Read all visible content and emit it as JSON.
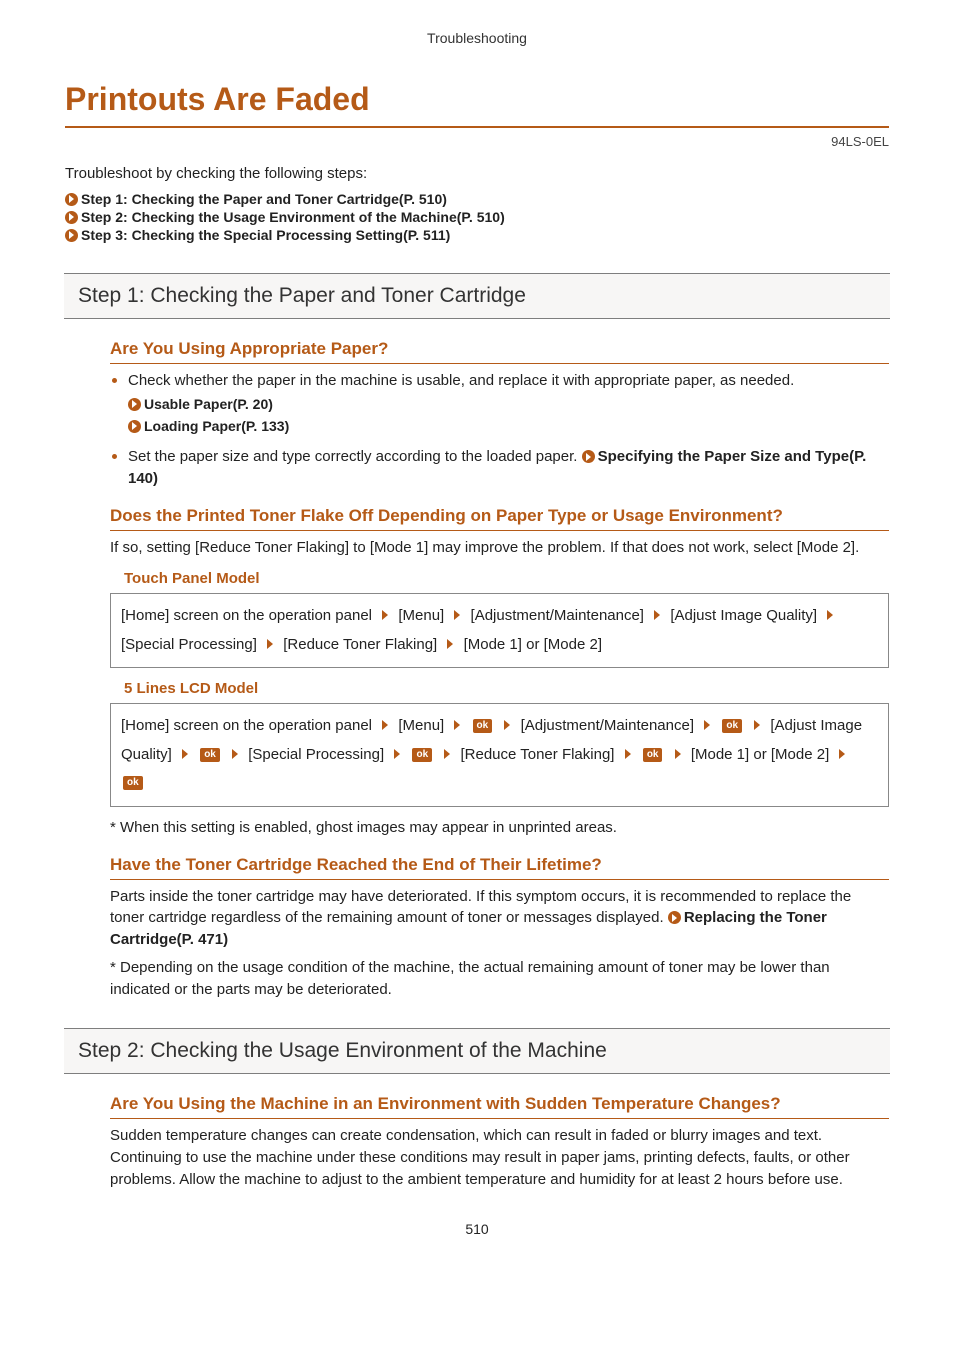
{
  "header": {
    "running_head": "Troubleshooting",
    "title": "Printouts Are Faded",
    "code": "94LS-0EL",
    "intro": "Troubleshoot by checking the following steps:"
  },
  "toc": {
    "items": [
      "Step 1: Checking the Paper and Toner Cartridge(P. 510)",
      "Step 2: Checking the Usage Environment of the Machine(P. 510)",
      "Step 3: Checking the Special Processing Setting(P. 511)"
    ]
  },
  "s1": {
    "title": "Step 1: Checking the Paper and Toner Cartridge",
    "q1": {
      "heading": "Are You Using Appropriate Paper?",
      "b1": "Check whether the paper in the machine is usable, and replace it with appropriate paper, as needed.",
      "r1": "Usable Paper(P. 20)",
      "r2": "Loading Paper(P. 133)",
      "b2a": "Set the paper size and type correctly according to the loaded paper. ",
      "b2b": "Specifying the Paper Size and Type(P. 140)"
    },
    "q2": {
      "heading": "Does the Printed Toner Flake Off Depending on Paper Type or Usage Environment?",
      "para": "If so, setting [Reduce Toner Flaking] to [Mode 1] may improve the problem. If that does not work, select [Mode 2].",
      "touch_label": "Touch Panel Model",
      "lcd_label": "5 Lines LCD Model",
      "note": "* When this setting is enabled, ghost images may appear in unprinted areas.",
      "touch_path": {
        "p0": "[Home] screen on the operation panel",
        "p1": "[Menu]",
        "p2": "[Adjustment/Maintenance]",
        "p3": "[Adjust Image Quality]",
        "p4": "[Special Processing]",
        "p5": "[Reduce Toner Flaking]",
        "p6": "[Mode 1] or [Mode 2]"
      },
      "lcd_path": {
        "p0": "[Home] screen on the operation panel",
        "p1": "[Menu]",
        "p2": "[Adjustment/Maintenance]",
        "p3": "[Adjust Image Quality]",
        "p4": "[Special Processing]",
        "p5": "[Reduce Toner Flaking]",
        "p6": "[Mode 1] or [Mode 2]"
      },
      "ok": "ok"
    },
    "q3": {
      "heading": "Have the Toner Cartridge Reached the End of Their Lifetime?",
      "p1a": "Parts inside the toner cartridge may have deteriorated. If this symptom occurs, it is recommended to replace the toner cartridge regardless of the remaining amount of toner or messages displayed. ",
      "p1b": "Replacing the Toner Cartridge(P. 471)",
      "p2": "* Depending on the usage condition of the machine, the actual remaining amount of toner may be lower than indicated or the parts may be deteriorated."
    }
  },
  "s2": {
    "title": "Step 2: Checking the Usage Environment of the Machine",
    "q1": {
      "heading": "Are You Using the Machine in an Environment with Sudden Temperature Changes?",
      "para": "Sudden temperature changes can create condensation, which can result in faded or blurry images and text. Continuing to use the machine under these conditions may result in paper jams, printing defects, faults, or other problems. Allow the machine to adjust to the ambient temperature and humidity for at least 2 hours before use."
    }
  },
  "footer": {
    "page": "510"
  }
}
